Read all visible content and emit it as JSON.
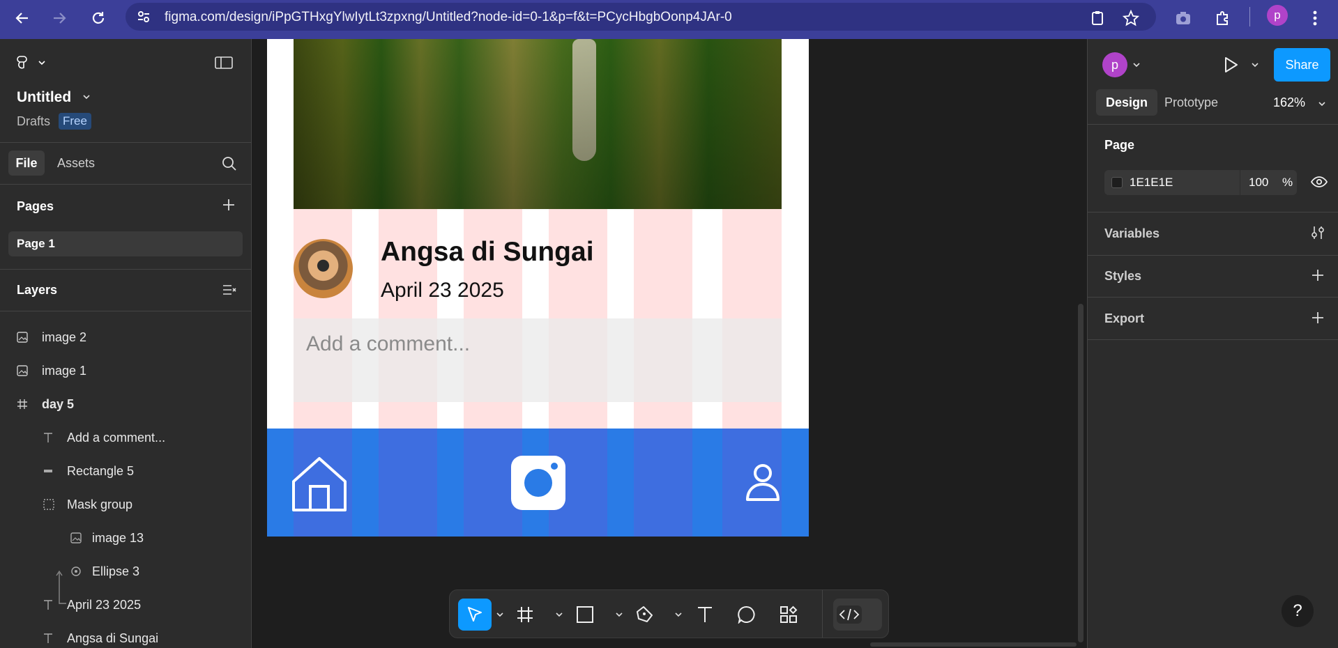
{
  "browser": {
    "url": "figma.com/design/iPpGTHxgYlwIytLt3zpxng/Untitled?node-id=0-1&p=f&t=PCycHbgbOonp4JAr-0",
    "profile_initial": "p"
  },
  "file": {
    "title": "Untitled",
    "location": "Drafts",
    "plan": "Free"
  },
  "left_tabs": {
    "file": "File",
    "assets": "Assets"
  },
  "pages": {
    "header": "Pages",
    "items": [
      {
        "label": "Page 1"
      }
    ]
  },
  "layers": {
    "header": "Layers",
    "items": [
      {
        "label": "image 2",
        "icon": "image-icon"
      },
      {
        "label": "image 1",
        "icon": "image-icon"
      },
      {
        "label": "day 5",
        "icon": "frame-icon"
      },
      {
        "label": "Add a comment...",
        "icon": "text-icon"
      },
      {
        "label": "Rectangle 5",
        "icon": "rectangle-icon"
      },
      {
        "label": "Mask group",
        "icon": "mask-group-icon"
      },
      {
        "label": "image 13",
        "icon": "image-icon"
      },
      {
        "label": "Ellipse 3",
        "icon": "ellipse-icon"
      },
      {
        "label": "April 23 2025",
        "icon": "text-icon"
      },
      {
        "label": "Angsa di Sungai",
        "icon": "text-icon"
      }
    ]
  },
  "canvas": {
    "post_title": "Angsa di Sungai",
    "post_date": "April 23 2025",
    "comment_placeholder": "Add a comment...",
    "nav_icons": [
      "home-icon",
      "instagram-camera-icon",
      "profile-icon"
    ],
    "colors": {
      "bottom_bar": "#2a7be6",
      "grid_overlay": "#ffe0e0"
    }
  },
  "toolbar": {
    "tools": [
      "move-tool",
      "frame-tool",
      "rectangle-tool",
      "pen-tool",
      "text-tool",
      "comment-tool",
      "actions-tool",
      "dev-mode-toggle"
    ]
  },
  "right_panel": {
    "user_initial": "p",
    "share_label": "Share",
    "tabs": {
      "design": "Design",
      "prototype": "Prototype"
    },
    "zoom": "162%",
    "page_section": {
      "header": "Page",
      "background_hex": "1E1E1E",
      "opacity": "100",
      "opacity_unit": "%"
    },
    "variables_label": "Variables",
    "styles_label": "Styles",
    "export_label": "Export",
    "help_label": "?"
  }
}
